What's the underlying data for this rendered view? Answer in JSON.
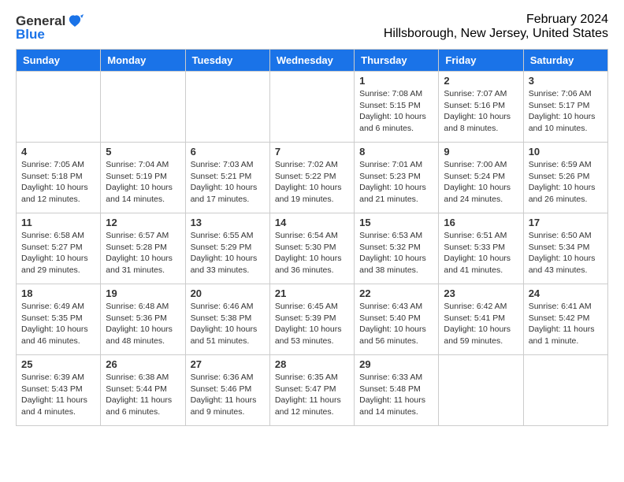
{
  "header": {
    "title": "February 2024",
    "subtitle": "Hillsborough, New Jersey, United States",
    "logo_general": "General",
    "logo_blue": "Blue"
  },
  "weekdays": [
    "Sunday",
    "Monday",
    "Tuesday",
    "Wednesday",
    "Thursday",
    "Friday",
    "Saturday"
  ],
  "weeks": [
    [
      {
        "day": "",
        "info": ""
      },
      {
        "day": "",
        "info": ""
      },
      {
        "day": "",
        "info": ""
      },
      {
        "day": "",
        "info": ""
      },
      {
        "day": "1",
        "info": "Sunrise: 7:08 AM\nSunset: 5:15 PM\nDaylight: 10 hours\nand 6 minutes."
      },
      {
        "day": "2",
        "info": "Sunrise: 7:07 AM\nSunset: 5:16 PM\nDaylight: 10 hours\nand 8 minutes."
      },
      {
        "day": "3",
        "info": "Sunrise: 7:06 AM\nSunset: 5:17 PM\nDaylight: 10 hours\nand 10 minutes."
      }
    ],
    [
      {
        "day": "4",
        "info": "Sunrise: 7:05 AM\nSunset: 5:18 PM\nDaylight: 10 hours\nand 12 minutes."
      },
      {
        "day": "5",
        "info": "Sunrise: 7:04 AM\nSunset: 5:19 PM\nDaylight: 10 hours\nand 14 minutes."
      },
      {
        "day": "6",
        "info": "Sunrise: 7:03 AM\nSunset: 5:21 PM\nDaylight: 10 hours\nand 17 minutes."
      },
      {
        "day": "7",
        "info": "Sunrise: 7:02 AM\nSunset: 5:22 PM\nDaylight: 10 hours\nand 19 minutes."
      },
      {
        "day": "8",
        "info": "Sunrise: 7:01 AM\nSunset: 5:23 PM\nDaylight: 10 hours\nand 21 minutes."
      },
      {
        "day": "9",
        "info": "Sunrise: 7:00 AM\nSunset: 5:24 PM\nDaylight: 10 hours\nand 24 minutes."
      },
      {
        "day": "10",
        "info": "Sunrise: 6:59 AM\nSunset: 5:26 PM\nDaylight: 10 hours\nand 26 minutes."
      }
    ],
    [
      {
        "day": "11",
        "info": "Sunrise: 6:58 AM\nSunset: 5:27 PM\nDaylight: 10 hours\nand 29 minutes."
      },
      {
        "day": "12",
        "info": "Sunrise: 6:57 AM\nSunset: 5:28 PM\nDaylight: 10 hours\nand 31 minutes."
      },
      {
        "day": "13",
        "info": "Sunrise: 6:55 AM\nSunset: 5:29 PM\nDaylight: 10 hours\nand 33 minutes."
      },
      {
        "day": "14",
        "info": "Sunrise: 6:54 AM\nSunset: 5:30 PM\nDaylight: 10 hours\nand 36 minutes."
      },
      {
        "day": "15",
        "info": "Sunrise: 6:53 AM\nSunset: 5:32 PM\nDaylight: 10 hours\nand 38 minutes."
      },
      {
        "day": "16",
        "info": "Sunrise: 6:51 AM\nSunset: 5:33 PM\nDaylight: 10 hours\nand 41 minutes."
      },
      {
        "day": "17",
        "info": "Sunrise: 6:50 AM\nSunset: 5:34 PM\nDaylight: 10 hours\nand 43 minutes."
      }
    ],
    [
      {
        "day": "18",
        "info": "Sunrise: 6:49 AM\nSunset: 5:35 PM\nDaylight: 10 hours\nand 46 minutes."
      },
      {
        "day": "19",
        "info": "Sunrise: 6:48 AM\nSunset: 5:36 PM\nDaylight: 10 hours\nand 48 minutes."
      },
      {
        "day": "20",
        "info": "Sunrise: 6:46 AM\nSunset: 5:38 PM\nDaylight: 10 hours\nand 51 minutes."
      },
      {
        "day": "21",
        "info": "Sunrise: 6:45 AM\nSunset: 5:39 PM\nDaylight: 10 hours\nand 53 minutes."
      },
      {
        "day": "22",
        "info": "Sunrise: 6:43 AM\nSunset: 5:40 PM\nDaylight: 10 hours\nand 56 minutes."
      },
      {
        "day": "23",
        "info": "Sunrise: 6:42 AM\nSunset: 5:41 PM\nDaylight: 10 hours\nand 59 minutes."
      },
      {
        "day": "24",
        "info": "Sunrise: 6:41 AM\nSunset: 5:42 PM\nDaylight: 11 hours\nand 1 minute."
      }
    ],
    [
      {
        "day": "25",
        "info": "Sunrise: 6:39 AM\nSunset: 5:43 PM\nDaylight: 11 hours\nand 4 minutes."
      },
      {
        "day": "26",
        "info": "Sunrise: 6:38 AM\nSunset: 5:44 PM\nDaylight: 11 hours\nand 6 minutes."
      },
      {
        "day": "27",
        "info": "Sunrise: 6:36 AM\nSunset: 5:46 PM\nDaylight: 11 hours\nand 9 minutes."
      },
      {
        "day": "28",
        "info": "Sunrise: 6:35 AM\nSunset: 5:47 PM\nDaylight: 11 hours\nand 12 minutes."
      },
      {
        "day": "29",
        "info": "Sunrise: 6:33 AM\nSunset: 5:48 PM\nDaylight: 11 hours\nand 14 minutes."
      },
      {
        "day": "",
        "info": ""
      },
      {
        "day": "",
        "info": ""
      }
    ]
  ]
}
